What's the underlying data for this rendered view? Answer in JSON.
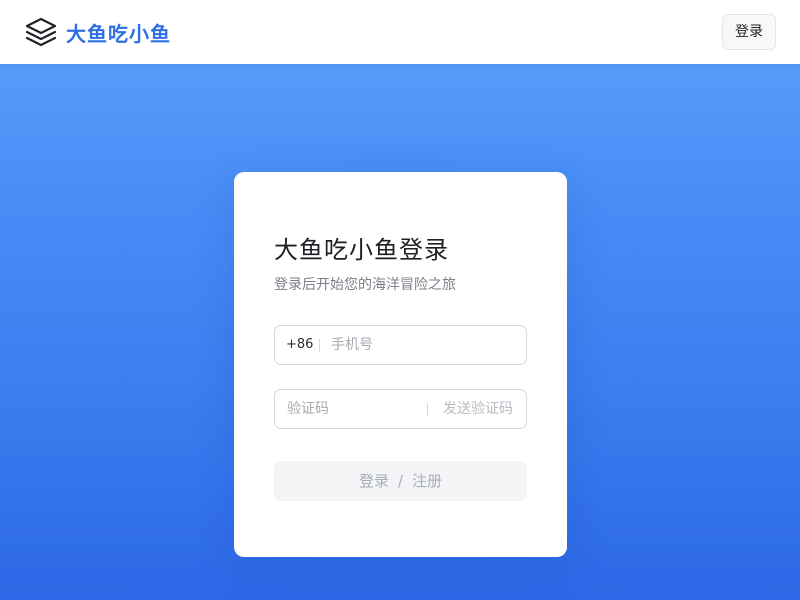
{
  "header": {
    "brand_icon": "layers-stack-icon",
    "brand_name": "大鱼吃小鱼",
    "login_button_label": "登录",
    "brand_color": "#2f6fe4"
  },
  "login_card": {
    "title": "大鱼吃小鱼登录",
    "subtitle": "登录后开始您的海洋冒险之旅",
    "phone": {
      "country_code": "+86",
      "placeholder": "手机号",
      "value": ""
    },
    "code": {
      "placeholder": "验证码",
      "value": "",
      "send_code_label": "发送验证码"
    },
    "submit": {
      "login_label": "登录",
      "separator": "/",
      "register_label": "注册"
    }
  },
  "colors": {
    "background_top": "#5ea3fb",
    "background_bottom": "#2d68e6",
    "card": "#ffffff"
  }
}
